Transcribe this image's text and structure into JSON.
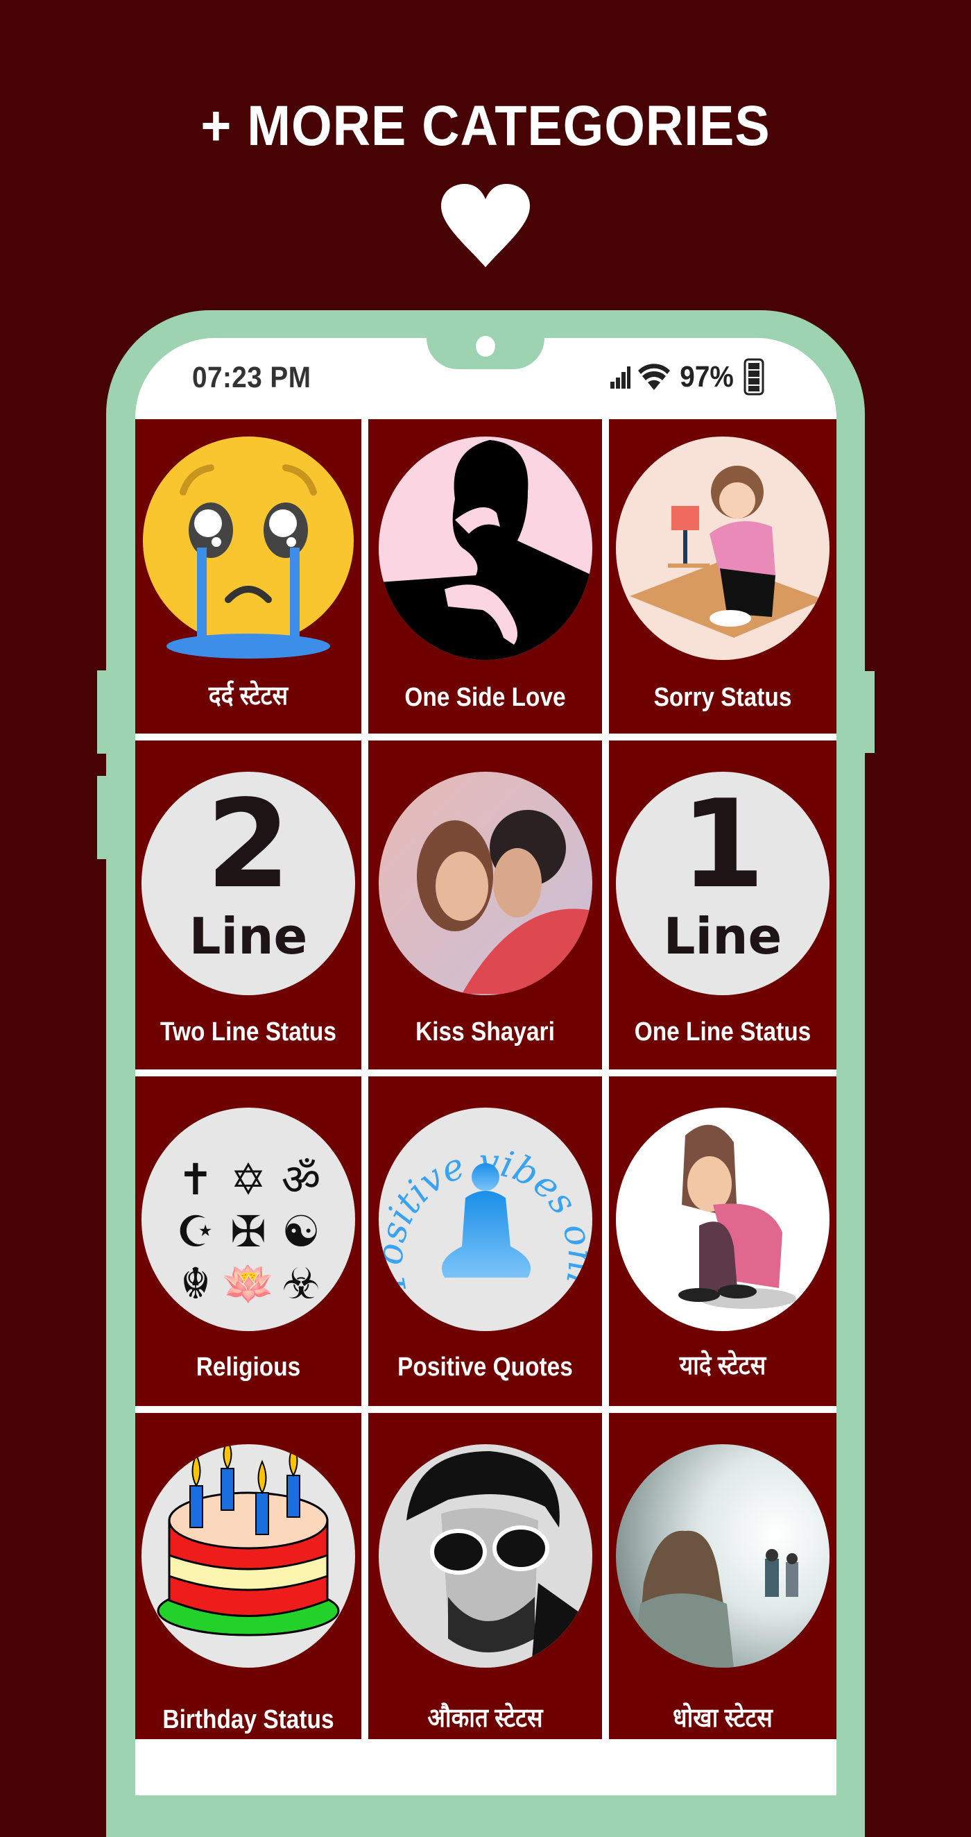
{
  "header": {
    "title": "+ MORE CATEGORIES",
    "icon": "heart-icon"
  },
  "status_bar": {
    "time": "07:23 PM",
    "battery_percent": "97%",
    "signal_icon": "signal-bars-icon",
    "wifi_icon": "wifi-icon",
    "battery_icon": "battery-icon"
  },
  "colors": {
    "background": "#470204",
    "phone_frame": "#9dd3b1",
    "tile_background": "#6e0000",
    "label_text": "#ffffff"
  },
  "categories": [
    {
      "label": "दर्द स्टेटस",
      "thumbnail": "crying-face-emoji"
    },
    {
      "label": "One Side Love",
      "thumbnail": "embracing-silhouette"
    },
    {
      "label": "Sorry Status",
      "thumbnail": "sad-girl-with-phone"
    },
    {
      "label": "Two Line Status",
      "thumbnail": "2-line-badge",
      "badge_number": "2",
      "badge_word": "Line"
    },
    {
      "label": "Kiss Shayari",
      "thumbnail": "couple-photo"
    },
    {
      "label": "One Line Status",
      "thumbnail": "1-line-badge",
      "badge_number": "1",
      "badge_word": "Line"
    },
    {
      "label": "Religious",
      "thumbnail": "religious-symbols",
      "symbols": [
        "✝",
        "✡",
        "ॐ",
        "☪",
        "✠",
        "☯",
        "☬",
        "🪷",
        "☣"
      ]
    },
    {
      "label": "Positive Quotes",
      "thumbnail": "positive-vibes-only",
      "thumb_text": "Positive vibes only"
    },
    {
      "label": "यादे स्टेटस",
      "thumbnail": "sad-girl-sitting"
    },
    {
      "label": "Birthday Status",
      "thumbnail": "birthday-cake"
    },
    {
      "label": "औकात स्टेटस",
      "thumbnail": "man-with-sunglasses"
    },
    {
      "label": "धोखा स्टेटस",
      "thumbnail": "girl-watching-couple"
    }
  ]
}
